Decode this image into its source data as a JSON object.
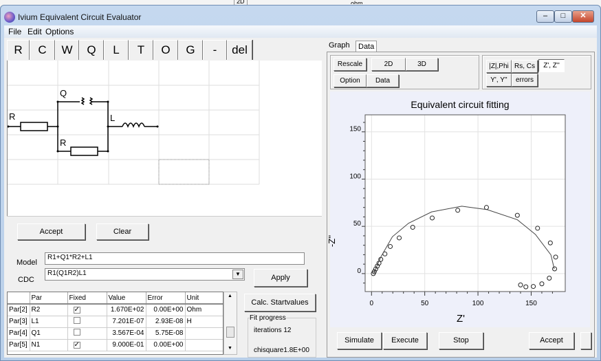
{
  "background_window": {
    "texts": [
      "2D",
      "ohm"
    ]
  },
  "window": {
    "title": "Ivium Equivalent  Circuit Evaluator",
    "controls": [
      "minimize",
      "maximize",
      "close"
    ]
  },
  "menu": [
    "File",
    "Edit",
    "Options"
  ],
  "components": [
    "R",
    "C",
    "W",
    "Q",
    "L",
    "T",
    "O",
    "G",
    "-",
    "del"
  ],
  "circuit": {
    "labels": {
      "r1": "R",
      "q": "Q",
      "r2": "R",
      "l": "L"
    }
  },
  "circuit_buttons": {
    "accept": "Accept",
    "clear": "Clear"
  },
  "model": {
    "label": "Model",
    "value": "R1+Q1*R2+L1"
  },
  "cdc": {
    "label": "CDC",
    "value": "R1(Q1R2)L1"
  },
  "apply": "Apply",
  "table": {
    "headers": [
      "",
      "Par",
      "Fixed",
      "Value",
      "Error",
      "Unit"
    ],
    "rows": [
      {
        "id": "Par[2]",
        "par": "R2",
        "fixed": true,
        "value": "1.670E+02",
        "error": "0.00E+00",
        "unit": "Ohm"
      },
      {
        "id": "Par[3]",
        "par": "L1",
        "fixed": false,
        "value": "7.201E-07",
        "error": "2.93E-08",
        "unit": "H"
      },
      {
        "id": "Par[4]",
        "par": "Q1",
        "fixed": false,
        "value": "3.567E-04",
        "error": "5.75E-08",
        "unit": ""
      },
      {
        "id": "Par[5]",
        "par": "N1",
        "fixed": true,
        "value": "9.000E-01",
        "error": "0.00E+00",
        "unit": ""
      }
    ]
  },
  "calc_startvalues": "Calc. Startvalues",
  "fit_progress": {
    "title": "Fit progress",
    "iterations": "iterations 12",
    "chisquare": "chisquare1.8E+00"
  },
  "tabs": [
    {
      "label": "Graph",
      "active": true
    },
    {
      "label": "Data",
      "active": false
    }
  ],
  "graph_buttons": {
    "rescale": "Rescale",
    "d2": "2D",
    "d3": "3D",
    "option": "Option",
    "data": "Data"
  },
  "plot_modes": [
    {
      "label": "|Z|,Phi"
    },
    {
      "label": "Rs, Cs"
    },
    {
      "label": "Z', Z''",
      "selected": true
    },
    {
      "label": "Y', Y''"
    },
    {
      "label": "errors"
    }
  ],
  "bottom_buttons": {
    "simulate": "Simulate",
    "execute": "Execute",
    "stop": "Stop",
    "accept": "Accept"
  },
  "chart_data": {
    "type": "scatter",
    "title": "Equivalent circuit fitting",
    "xlabel": "Z'",
    "ylabel": "-Z''",
    "xlim": [
      -6,
      182
    ],
    "ylim": [
      -19,
      168
    ],
    "xticks": [
      0,
      50,
      100,
      150
    ],
    "yticks": [
      0,
      50,
      100,
      150
    ],
    "grid": true,
    "series": [
      {
        "kind": "points",
        "marker": "open-circle",
        "x": [
          1.7,
          2.6,
          3.9,
          5.4,
          7,
          8.7,
          12.6,
          17.6,
          26,
          38.7,
          57,
          81,
          108,
          137,
          156,
          168,
          173,
          172,
          167,
          160,
          152,
          145,
          140
        ],
        "y": [
          0,
          2,
          4.8,
          7.9,
          11,
          15,
          20.8,
          28.7,
          37.8,
          49,
          58.9,
          67,
          70,
          61.7,
          48,
          32.5,
          17.5,
          5,
          -4.8,
          -10.8,
          -13.6,
          -14,
          -12
        ]
      },
      {
        "kind": "line",
        "x": [
          2.2,
          8.7,
          19.6,
          34.8,
          56.5,
          84.8,
          108.7,
          137,
          154,
          168.5,
          171.7
        ],
        "y": [
          0.7,
          17.5,
          39,
          53.3,
          65.3,
          71.3,
          67.7,
          57,
          41.4,
          19.9,
          5
        ]
      }
    ]
  }
}
